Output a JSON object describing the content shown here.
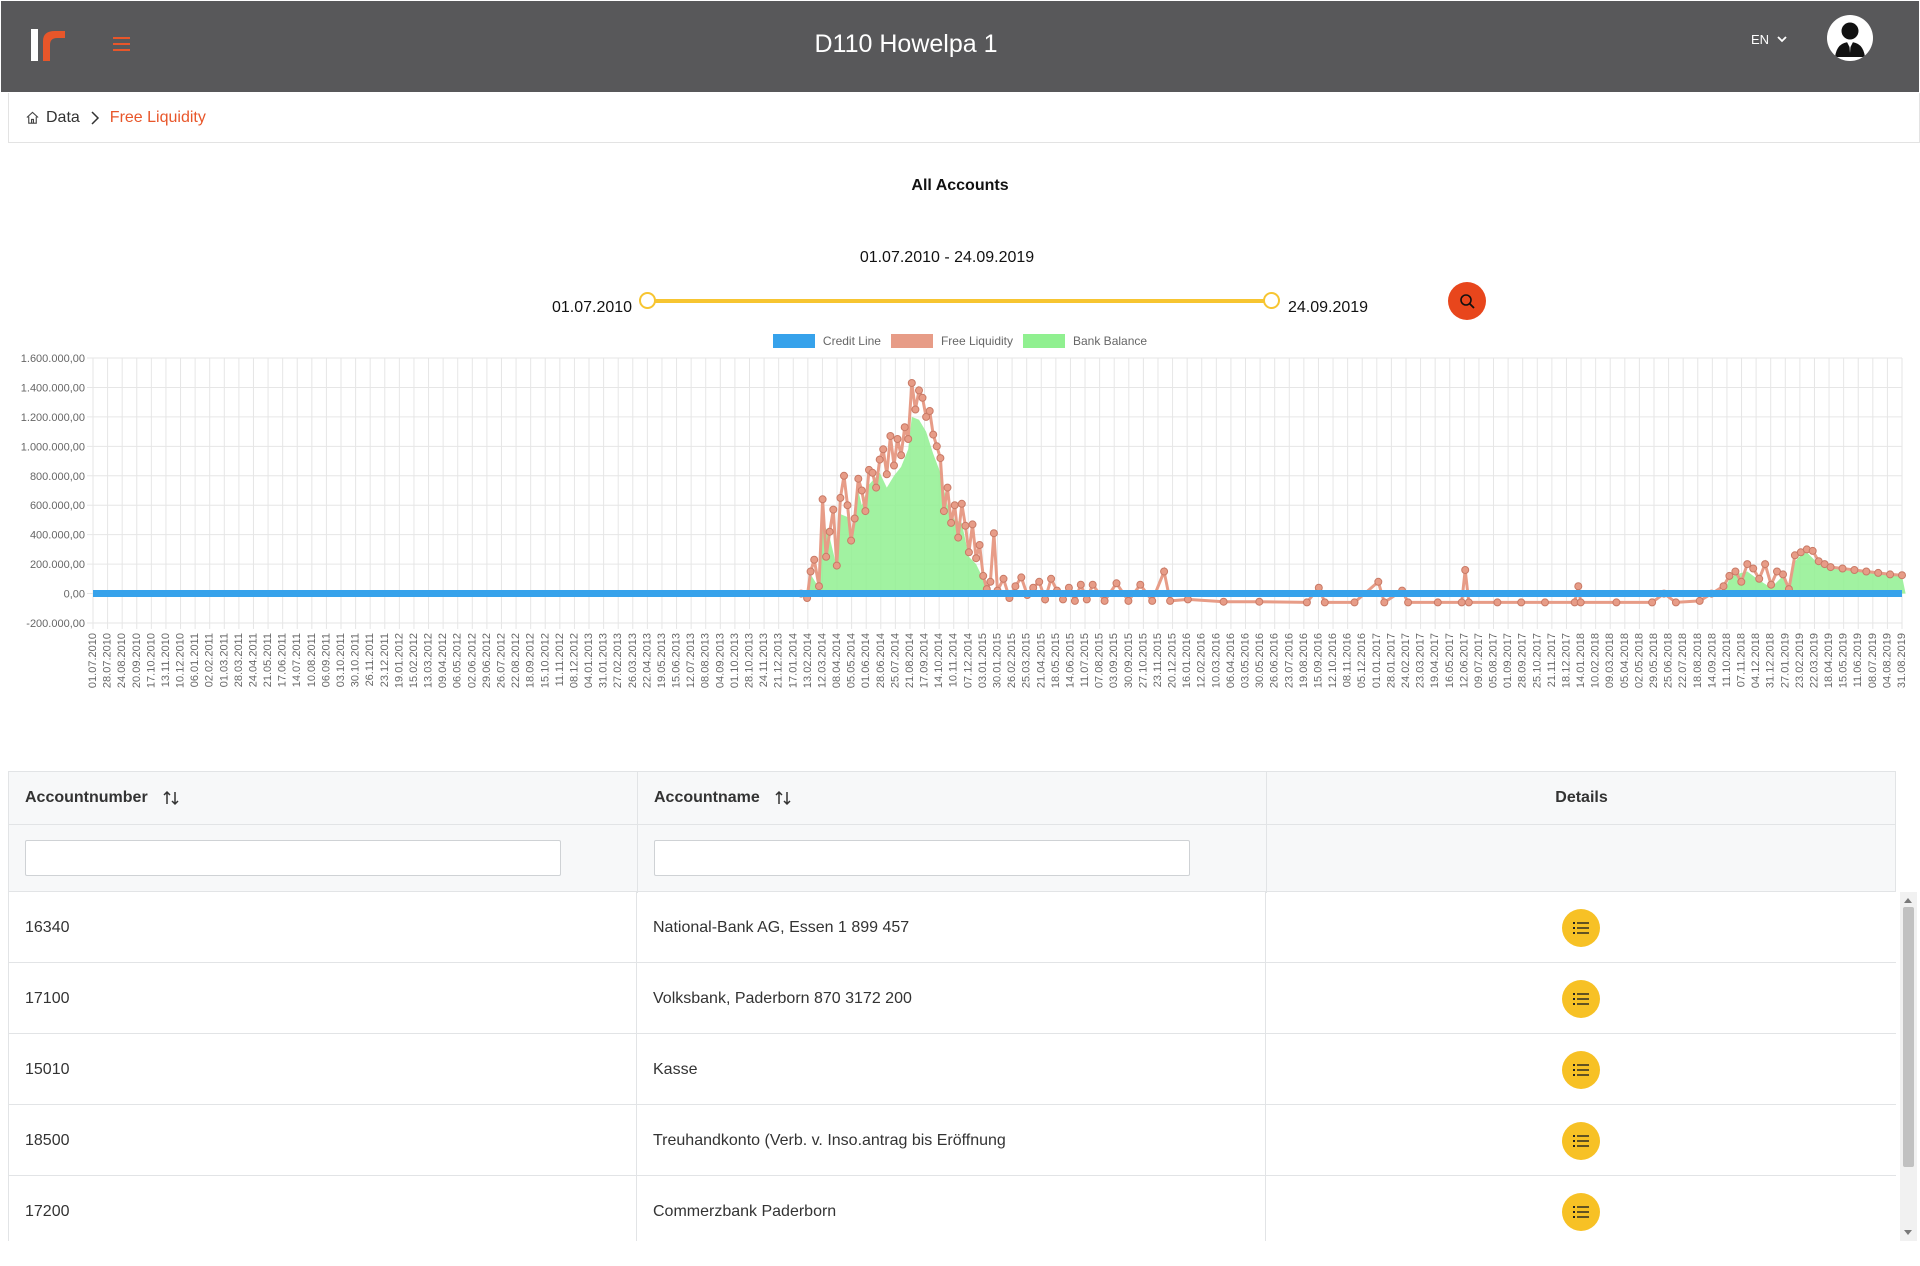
{
  "app": {
    "title": "D110 Howelpa 1",
    "language": "EN"
  },
  "breadcrumb": {
    "home": "Data",
    "current": "Free Liquidity"
  },
  "chart_header": {
    "title": "All Accounts",
    "range_text": "01.07.2010 - 24.09.2019",
    "range_min": "01.07.2010",
    "range_max": "24.09.2019"
  },
  "colors": {
    "brand_orange": "#e8562a",
    "slider_yellow": "#f7c531",
    "detail_button": "#f7c125",
    "credit_line": "#36a2eb",
    "free_liquidity": "#e79c87",
    "bank_balance": "#90f090"
  },
  "chart_data": {
    "type": "line",
    "legend_position": "top",
    "grid": true,
    "ylim": [
      -200000,
      1600000
    ],
    "y_ticks": [
      "-200.000,00",
      "0,00",
      "200.000,00",
      "400.000,00",
      "600.000,00",
      "800.000,00",
      "1.000.000,00",
      "1.200.000,00",
      "1.400.000,00",
      "1.600.000,00"
    ],
    "x_ticks": [
      "01.07.2010",
      "28.07.2010",
      "24.08.2010",
      "20.09.2010",
      "17.10.2010",
      "13.11.2010",
      "10.12.2010",
      "06.01.2011",
      "02.02.2011",
      "01.03.2011",
      "28.03.2011",
      "24.04.2011",
      "21.05.2011",
      "17.06.2011",
      "14.07.2011",
      "10.08.2011",
      "06.09.2011",
      "03.10.2011",
      "30.10.2011",
      "26.11.2011",
      "23.12.2011",
      "19.01.2012",
      "15.02.2012",
      "13.03.2012",
      "09.04.2012",
      "06.05.2012",
      "02.06.2012",
      "29.06.2012",
      "26.07.2012",
      "22.08.2012",
      "18.09.2012",
      "15.10.2012",
      "11.11.2012",
      "08.12.2012",
      "04.01.2013",
      "31.01.2013",
      "27.02.2013",
      "26.03.2013",
      "22.04.2013",
      "19.05.2013",
      "15.06.2013",
      "12.07.2013",
      "08.08.2013",
      "04.09.2013",
      "01.10.2013",
      "28.10.2013",
      "24.11.2013",
      "21.12.2013",
      "17.01.2014",
      "13.02.2014",
      "12.03.2014",
      "08.04.2014",
      "05.05.2014",
      "01.06.2014",
      "28.06.2014",
      "25.07.2014",
      "21.08.2014",
      "17.09.2014",
      "14.10.2014",
      "10.11.2014",
      "07.12.2014",
      "03.01.2015",
      "30.01.2015",
      "26.02.2015",
      "25.03.2015",
      "21.04.2015",
      "18.05.2015",
      "14.06.2015",
      "11.07.2015",
      "07.08.2015",
      "03.09.2015",
      "30.09.2015",
      "27.10.2015",
      "23.11.2015",
      "20.12.2015",
      "16.01.2016",
      "12.02.2016",
      "10.03.2016",
      "06.04.2016",
      "03.05.2016",
      "30.05.2016",
      "26.06.2016",
      "23.07.2016",
      "19.08.2016",
      "15.09.2016",
      "12.10.2016",
      "08.11.2016",
      "05.12.2016",
      "01.01.2017",
      "28.01.2017",
      "24.02.2017",
      "23.03.2017",
      "19.04.2017",
      "16.05.2017",
      "12.06.2017",
      "09.07.2017",
      "05.08.2017",
      "01.09.2017",
      "28.09.2017",
      "25.10.2017",
      "21.11.2017",
      "18.12.2017",
      "14.01.2018",
      "10.02.2018",
      "09.03.2018",
      "05.04.2018",
      "02.05.2018",
      "29.05.2018",
      "25.06.2018",
      "22.07.2018",
      "18.08.2018",
      "14.09.2018",
      "11.10.2018",
      "07.11.2018",
      "04.12.2018",
      "31.12.2018",
      "27.01.2019",
      "23.02.2019",
      "22.03.2019",
      "18.04.2019",
      "15.05.2019",
      "11.06.2019",
      "08.07.2019",
      "04.08.2019",
      "31.08.2019"
    ],
    "series": [
      {
        "name": "Credit Line",
        "color": "#36a2eb",
        "points": [
          [
            0,
            0
          ],
          [
            124,
            0
          ]
        ]
      },
      {
        "name": "Free Liquidity",
        "color": "#e79c87",
        "points": [
          [
            59.5,
            0
          ],
          [
            60,
            -30000
          ],
          [
            60.3,
            150000
          ],
          [
            60.6,
            230000
          ],
          [
            61,
            50000
          ],
          [
            61.3,
            640000
          ],
          [
            61.6,
            250000
          ],
          [
            61.9,
            420000
          ],
          [
            62.2,
            570000
          ],
          [
            62.5,
            190000
          ],
          [
            62.8,
            650000
          ],
          [
            63.1,
            800000
          ],
          [
            63.4,
            600000
          ],
          [
            63.7,
            360000
          ],
          [
            64,
            510000
          ],
          [
            64.3,
            780000
          ],
          [
            64.6,
            700000
          ],
          [
            64.9,
            560000
          ],
          [
            65.2,
            840000
          ],
          [
            65.5,
            820000
          ],
          [
            65.8,
            720000
          ],
          [
            66.1,
            910000
          ],
          [
            66.4,
            980000
          ],
          [
            66.7,
            810000
          ],
          [
            67,
            1070000
          ],
          [
            67.3,
            870000
          ],
          [
            67.6,
            1050000
          ],
          [
            67.9,
            940000
          ],
          [
            68.2,
            1130000
          ],
          [
            68.5,
            1050000
          ],
          [
            68.8,
            1430000
          ],
          [
            69.1,
            1250000
          ],
          [
            69.4,
            1380000
          ],
          [
            69.7,
            1330000
          ],
          [
            70,
            1200000
          ],
          [
            70.3,
            1240000
          ],
          [
            70.6,
            1080000
          ],
          [
            70.9,
            1000000
          ],
          [
            71.2,
            920000
          ],
          [
            71.5,
            560000
          ],
          [
            71.8,
            720000
          ],
          [
            72.1,
            480000
          ],
          [
            72.4,
            600000
          ],
          [
            72.7,
            380000
          ],
          [
            73,
            610000
          ],
          [
            73.3,
            460000
          ],
          [
            73.6,
            280000
          ],
          [
            73.9,
            470000
          ],
          [
            74.2,
            240000
          ],
          [
            74.5,
            330000
          ],
          [
            74.8,
            120000
          ],
          [
            75.1,
            30000
          ],
          [
            75.4,
            80000
          ],
          [
            75.7,
            410000
          ],
          [
            76,
            20000
          ],
          [
            76.5,
            100000
          ],
          [
            77,
            -30000
          ],
          [
            77.5,
            50000
          ],
          [
            78,
            110000
          ],
          [
            78.5,
            -10000
          ],
          [
            79,
            40000
          ],
          [
            79.5,
            80000
          ],
          [
            80,
            -40000
          ],
          [
            80.5,
            100000
          ],
          [
            81,
            20000
          ],
          [
            81.5,
            -40000
          ],
          [
            82,
            40000
          ],
          [
            82.5,
            -50000
          ],
          [
            83,
            60000
          ],
          [
            83.5,
            -40000
          ],
          [
            84,
            60000
          ],
          [
            85,
            -50000
          ],
          [
            86,
            70000
          ],
          [
            87,
            -50000
          ],
          [
            88,
            60000
          ],
          [
            89,
            -50000
          ],
          [
            90,
            150000
          ],
          [
            90.5,
            -50000
          ],
          [
            92,
            -40000
          ],
          [
            95,
            -55000
          ],
          [
            98,
            -55000
          ],
          [
            102,
            -60000
          ],
          [
            103,
            40000
          ],
          [
            103.5,
            -60000
          ],
          [
            106,
            -60000
          ],
          [
            108,
            80000
          ],
          [
            108.5,
            -60000
          ],
          [
            110,
            20000
          ],
          [
            110.5,
            -60000
          ],
          [
            113,
            -60000
          ],
          [
            115,
            -60000
          ],
          [
            115.3,
            160000
          ],
          [
            115.6,
            -60000
          ],
          [
            118,
            -60000
          ],
          [
            120,
            -60000
          ],
          [
            122,
            -60000
          ],
          [
            124.5,
            -60000
          ],
          [
            124.8,
            50000
          ],
          [
            125,
            -60000
          ],
          [
            128,
            -60000
          ],
          [
            131,
            -60000
          ],
          [
            132,
            0
          ],
          [
            133,
            -60000
          ],
          [
            135,
            -50000
          ],
          [
            136,
            0
          ],
          [
            137,
            50000
          ],
          [
            137.5,
            120000
          ],
          [
            138,
            150000
          ],
          [
            138.5,
            80000
          ],
          [
            139,
            200000
          ],
          [
            139.5,
            170000
          ],
          [
            140,
            100000
          ],
          [
            140.5,
            200000
          ],
          [
            141,
            60000
          ],
          [
            141.5,
            150000
          ],
          [
            142,
            130000
          ],
          [
            142.5,
            30000
          ],
          [
            143,
            260000
          ],
          [
            143.5,
            280000
          ],
          [
            144,
            300000
          ],
          [
            144.5,
            290000
          ],
          [
            145,
            220000
          ],
          [
            145.5,
            200000
          ],
          [
            146,
            180000
          ],
          [
            147,
            170000
          ],
          [
            148,
            160000
          ],
          [
            149,
            150000
          ],
          [
            150,
            140000
          ],
          [
            151,
            130000
          ],
          [
            152,
            125000
          ]
        ]
      },
      {
        "name": "Bank Balance",
        "color": "#90f090",
        "points": [
          [
            60,
            0
          ],
          [
            60.3,
            130000
          ],
          [
            61,
            40000
          ],
          [
            61.3,
            500000
          ],
          [
            61.9,
            380000
          ],
          [
            62.5,
            180000
          ],
          [
            62.8,
            540000
          ],
          [
            63.4,
            520000
          ],
          [
            63.7,
            380000
          ],
          [
            64.3,
            700000
          ],
          [
            64.6,
            600000
          ],
          [
            65.2,
            740000
          ],
          [
            66.1,
            820000
          ],
          [
            66.7,
            720000
          ],
          [
            67.3,
            800000
          ],
          [
            67.9,
            860000
          ],
          [
            68.5,
            980000
          ],
          [
            68.8,
            1200000
          ],
          [
            69.4,
            1180000
          ],
          [
            70,
            1100000
          ],
          [
            70.6,
            950000
          ],
          [
            71.2,
            820000
          ],
          [
            71.8,
            600000
          ],
          [
            72.4,
            500000
          ],
          [
            73,
            480000
          ],
          [
            73.6,
            250000
          ],
          [
            74.2,
            200000
          ],
          [
            74.8,
            100000
          ],
          [
            75.1,
            0
          ],
          [
            137,
            0
          ],
          [
            137.5,
            100000
          ],
          [
            138,
            130000
          ],
          [
            139,
            150000
          ],
          [
            140,
            90000
          ],
          [
            141,
            40000
          ],
          [
            142,
            120000
          ],
          [
            142.5,
            20000
          ],
          [
            143,
            220000
          ],
          [
            143.5,
            260000
          ],
          [
            144,
            280000
          ],
          [
            145,
            200000
          ],
          [
            146,
            170000
          ],
          [
            148,
            150000
          ],
          [
            150,
            140000
          ],
          [
            152,
            120000
          ],
          [
            152.3,
            0
          ]
        ]
      }
    ]
  },
  "table": {
    "columns": {
      "accountnumber": "Accountnumber",
      "accountname": "Accountname",
      "details": "Details"
    },
    "filters": {
      "accountnumber": "",
      "accountname": ""
    },
    "rows": [
      {
        "number": "16340",
        "name": "National-Bank AG, Essen 1 899 457"
      },
      {
        "number": "17100",
        "name": "Volksbank, Paderborn 870 3172 200"
      },
      {
        "number": "15010",
        "name": "Kasse"
      },
      {
        "number": "18500",
        "name": "Treuhandkonto (Verb. v. Inso.antrag bis Eröffnung"
      },
      {
        "number": "17200",
        "name": "Commerzbank Paderborn"
      }
    ]
  },
  "icons": {
    "home": "home-icon",
    "chevron": "chevron-right-icon",
    "search": "search-icon",
    "menu": "hamburger-menu-icon",
    "details": "list-icon",
    "sort": "sort-icon",
    "user": "user-avatar-icon"
  }
}
